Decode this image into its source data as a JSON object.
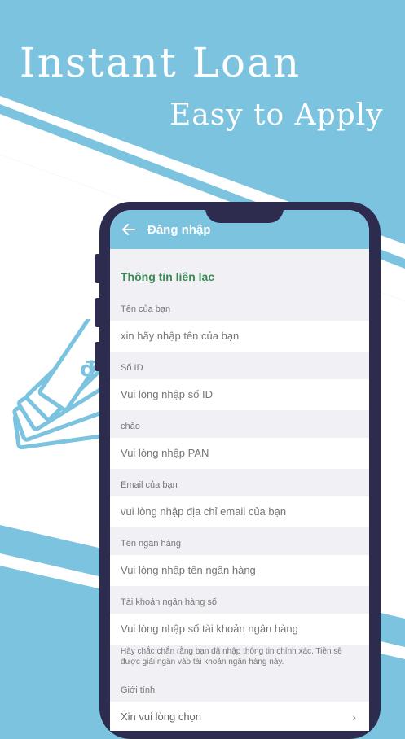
{
  "promo": {
    "headline": "Instant Loan",
    "subline": "Easy to Apply"
  },
  "colors": {
    "accent": "#7cc3e0",
    "phone_frame": "#2d2b4e",
    "section_green": "#3a8a55",
    "screen_bg": "#f1f0f5"
  },
  "app": {
    "title": "Đăng nhập",
    "back_icon": "arrow-left-icon",
    "section_title": "Thông tin liên lạc",
    "fields": [
      {
        "label": "Tên của bạn",
        "placeholder": "xin hãy nhập tên của bạn"
      },
      {
        "label": "Số ID",
        "placeholder": "Vui lòng nhập số ID"
      },
      {
        "label": "chảo",
        "placeholder": "Vui lòng nhập PAN"
      },
      {
        "label": "Email của bạn",
        "placeholder": "vui lòng nhập địa chỉ email của bạn"
      },
      {
        "label": "Tên ngân hàng",
        "placeholder": "Vui lòng nhập tên ngân hàng"
      },
      {
        "label": "Tài khoản ngân hàng số",
        "placeholder": "Vui lòng nhập số tài khoản ngân hàng"
      }
    ],
    "note": "Hãy chắc chắn rằng bạn đã nhập thông tin chính xác. Tiền sẽ được giải ngân vào tài khoản ngân hàng này.",
    "gender": {
      "label": "Giới tính",
      "placeholder": "Xin vui lòng chọn",
      "icon": "chevron-right-icon"
    }
  },
  "money_icon": "dong-banknotes-icon"
}
